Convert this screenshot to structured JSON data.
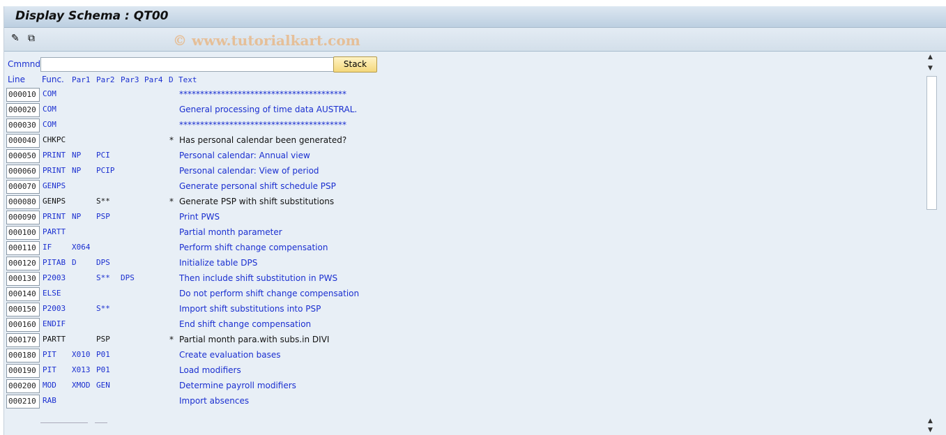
{
  "title": "Display Schema : QT00",
  "watermark": "© www.tutorialkart.com",
  "toolbar": {
    "icons": [
      "edit-icon",
      "other-object-icon"
    ]
  },
  "command": {
    "label": "Cmmnd",
    "value": "",
    "stack_label": "Stack"
  },
  "headers": {
    "line": "Line",
    "func": "Func.",
    "par1": "Par1",
    "par2": "Par2",
    "par3": "Par3",
    "par4": "Par4",
    "d": "D",
    "text": "Text"
  },
  "rows": [
    {
      "line": "000010",
      "func": "COM",
      "par1": "",
      "par2": "",
      "par3": "",
      "d": "",
      "text": "****************************************"
    },
    {
      "line": "000020",
      "func": "COM",
      "par1": "",
      "par2": "",
      "par3": "",
      "d": "",
      "text": "General processing of time data AUSTRAL."
    },
    {
      "line": "000030",
      "func": "COM",
      "par1": "",
      "par2": "",
      "par3": "",
      "d": "",
      "text": "****************************************"
    },
    {
      "line": "000040",
      "func": "CHKPC",
      "par1": "",
      "par2": "",
      "par3": "",
      "d": "*",
      "text": "Has personal calendar been generated?"
    },
    {
      "line": "000050",
      "func": "PRINT",
      "par1": "NP",
      "par2": "PCI",
      "par3": "",
      "d": "",
      "text": "Personal calendar: Annual view"
    },
    {
      "line": "000060",
      "func": "PRINT",
      "par1": "NP",
      "par2": "PCIP",
      "par3": "",
      "d": "",
      "text": "Personal calendar: View of period"
    },
    {
      "line": "000070",
      "func": "GENPS",
      "par1": "",
      "par2": "",
      "par3": "",
      "d": "",
      "text": "Generate personal shift schedule PSP"
    },
    {
      "line": "000080",
      "func": "GENPS",
      "par1": "",
      "par2": "S**",
      "par3": "",
      "d": "*",
      "text": "Generate PSP with shift substitutions"
    },
    {
      "line": "000090",
      "func": "PRINT",
      "par1": "NP",
      "par2": "PSP",
      "par3": "",
      "d": "",
      "text": "Print PWS"
    },
    {
      "line": "000100",
      "func": "PARTT",
      "par1": "",
      "par2": "",
      "par3": "",
      "d": "",
      "text": "Partial month parameter"
    },
    {
      "line": "000110",
      "func": "IF",
      "par1": "X064",
      "par2": "",
      "par3": "",
      "d": "",
      "text": "Perform shift change compensation"
    },
    {
      "line": "000120",
      "func": "PITAB",
      "par1": "D",
      "par2": "DPS",
      "par3": "",
      "d": "",
      "text": "Initialize table DPS"
    },
    {
      "line": "000130",
      "func": "P2003",
      "par1": "",
      "par2": "S**",
      "par3": "DPS",
      "d": "",
      "text": "Then include shift substitution in PWS"
    },
    {
      "line": "000140",
      "func": "ELSE",
      "par1": "",
      "par2": "",
      "par3": "",
      "d": "",
      "text": "Do not perform shift change compensation"
    },
    {
      "line": "000150",
      "func": "P2003",
      "par1": "",
      "par2": "S**",
      "par3": "",
      "d": "",
      "text": "Import shift substitutions into PSP"
    },
    {
      "line": "000160",
      "func": "ENDIF",
      "par1": "",
      "par2": "",
      "par3": "",
      "d": "",
      "text": "End shift change compensation"
    },
    {
      "line": "000170",
      "func": "PARTT",
      "par1": "",
      "par2": "PSP",
      "par3": "",
      "d": "*",
      "text": "Partial month para.with subs.in DIVI"
    },
    {
      "line": "000180",
      "func": "PIT",
      "par1": "X010",
      "par2": "P01",
      "par3": "",
      "d": "",
      "text": "Create evaluation bases"
    },
    {
      "line": "000190",
      "func": "PIT",
      "par1": "X013",
      "par2": "P01",
      "par3": "",
      "d": "",
      "text": "Load modifiers"
    },
    {
      "line": "000200",
      "func": "MOD",
      "par1": "XMOD",
      "par2": "GEN",
      "par3": "",
      "d": "",
      "text": "Determine payroll modifiers"
    },
    {
      "line": "000210",
      "func": "RAB",
      "par1": "",
      "par2": "",
      "par3": "",
      "d": "",
      "text": "Import absences"
    }
  ]
}
